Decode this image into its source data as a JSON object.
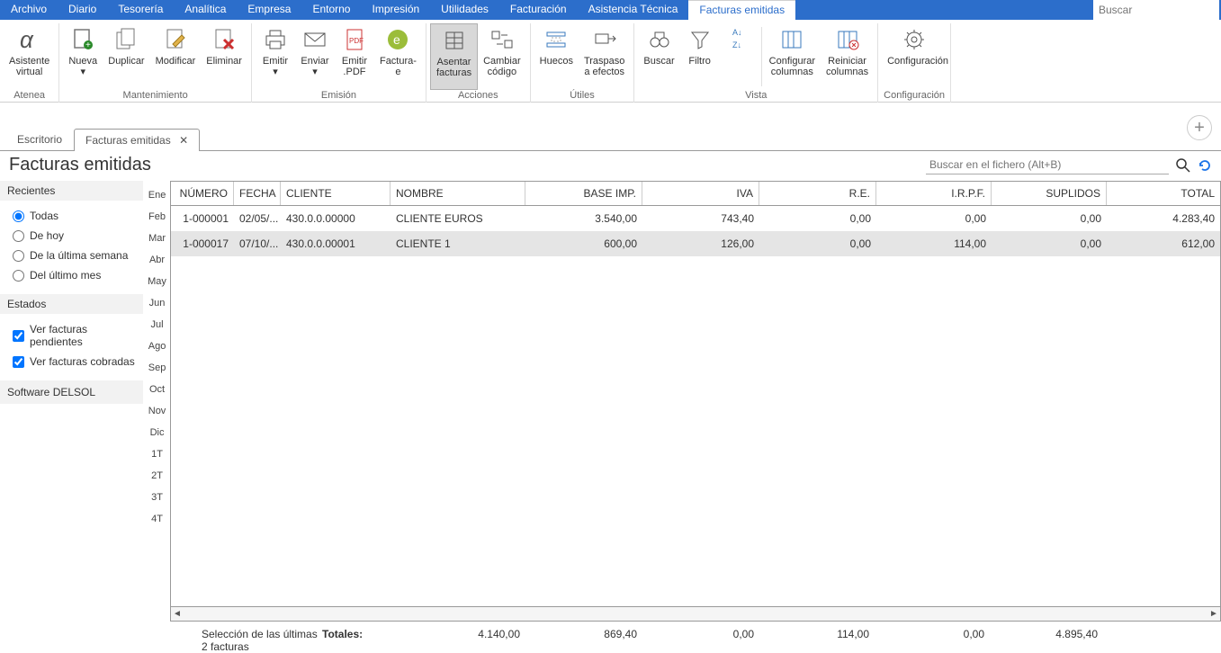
{
  "menubar": {
    "items": [
      "Archivo",
      "Diario",
      "Tesorería",
      "Analítica",
      "Empresa",
      "Entorno",
      "Impresión",
      "Utilidades",
      "Facturación",
      "Asistencia Técnica"
    ],
    "active_tab": "Facturas emitidas",
    "search_placeholder": "Buscar"
  },
  "ribbon": {
    "groups": [
      {
        "label": "Atenea",
        "buttons": [
          {
            "name": "asistente-virtual",
            "label": "Asistente\nvirtual"
          }
        ]
      },
      {
        "label": "Mantenimiento",
        "buttons": [
          {
            "name": "nueva",
            "label": "Nueva\n▾"
          },
          {
            "name": "duplicar",
            "label": "Duplicar"
          },
          {
            "name": "modificar",
            "label": "Modificar"
          },
          {
            "name": "eliminar",
            "label": "Eliminar"
          }
        ]
      },
      {
        "label": "Emisión",
        "buttons": [
          {
            "name": "emitir",
            "label": "Emitir\n▾"
          },
          {
            "name": "enviar",
            "label": "Enviar\n▾"
          },
          {
            "name": "emitir-pdf",
            "label": "Emitir\n.PDF"
          },
          {
            "name": "factura-e",
            "label": "Factura-\ne"
          }
        ]
      },
      {
        "label": "Acciones",
        "buttons": [
          {
            "name": "asentar-facturas",
            "label": "Asentar\nfacturas",
            "selected": true
          },
          {
            "name": "cambiar-codigo",
            "label": "Cambiar\ncódigo"
          }
        ]
      },
      {
        "label": "Útiles",
        "buttons": [
          {
            "name": "huecos",
            "label": "Huecos"
          },
          {
            "name": "traspaso-efectos",
            "label": "Traspaso\na efectos"
          }
        ]
      },
      {
        "label": "Vista",
        "buttons": [
          {
            "name": "buscar",
            "label": "Buscar"
          },
          {
            "name": "filtro",
            "label": "Filtro"
          },
          {
            "name": "orden",
            "label": ""
          },
          {
            "name": "configurar-columnas",
            "label": "Configurar\ncolumnas"
          },
          {
            "name": "reiniciar-columnas",
            "label": "Reiniciar\ncolumnas"
          }
        ]
      },
      {
        "label": "Configuración",
        "buttons": [
          {
            "name": "configuracion",
            "label": "Configuración"
          }
        ]
      }
    ]
  },
  "doc_tabs": {
    "items": [
      {
        "label": "Escritorio",
        "closable": false,
        "active": false
      },
      {
        "label": "Facturas emitidas",
        "closable": true,
        "active": true
      }
    ]
  },
  "page": {
    "title": "Facturas emitidas",
    "file_search_placeholder": "Buscar en el fichero (Alt+B)"
  },
  "sidebar": {
    "recent_head": "Recientes",
    "recent": [
      {
        "label": "Todas",
        "checked": true
      },
      {
        "label": "De hoy",
        "checked": false
      },
      {
        "label": "De la última semana",
        "checked": false
      },
      {
        "label": "Del último mes",
        "checked": false
      }
    ],
    "states_head": "Estados",
    "states": [
      {
        "label": "Ver facturas pendientes",
        "checked": true
      },
      {
        "label": "Ver facturas cobradas",
        "checked": true
      }
    ],
    "software": "Software DELSOL"
  },
  "months": [
    "Ene",
    "Feb",
    "Mar",
    "Abr",
    "May",
    "Jun",
    "Jul",
    "Ago",
    "Sep",
    "Oct",
    "Nov",
    "Dic",
    "1T",
    "2T",
    "3T",
    "4T"
  ],
  "grid": {
    "columns": [
      "NÚMERO",
      "FECHA",
      "CLIENTE",
      "NOMBRE",
      "BASE IMP.",
      "IVA",
      "R.E.",
      "I.R.P.F.",
      "SUPLIDOS",
      "TOTAL"
    ],
    "rows": [
      {
        "numero": "1-000001",
        "fecha": "02/05/...",
        "cliente": "430.0.0.00000",
        "nombre": "CLIENTE EUROS",
        "base": "3.540,00",
        "iva": "743,40",
        "re": "0,00",
        "irpf": "0,00",
        "sup": "0,00",
        "total": "4.283,40",
        "selected": false
      },
      {
        "numero": "1-000017",
        "fecha": "07/10/...",
        "cliente": "430.0.0.00001",
        "nombre": "CLIENTE 1",
        "base": "600,00",
        "iva": "126,00",
        "re": "0,00",
        "irpf": "114,00",
        "sup": "0,00",
        "total": "612,00",
        "selected": true
      }
    ]
  },
  "footer": {
    "selection": "Selección de las últimas 2 facturas",
    "totals_label": "Totales:",
    "base": "4.140,00",
    "iva": "869,40",
    "re": "0,00",
    "irpf": "114,00",
    "sup": "0,00",
    "total": "4.895,40"
  }
}
